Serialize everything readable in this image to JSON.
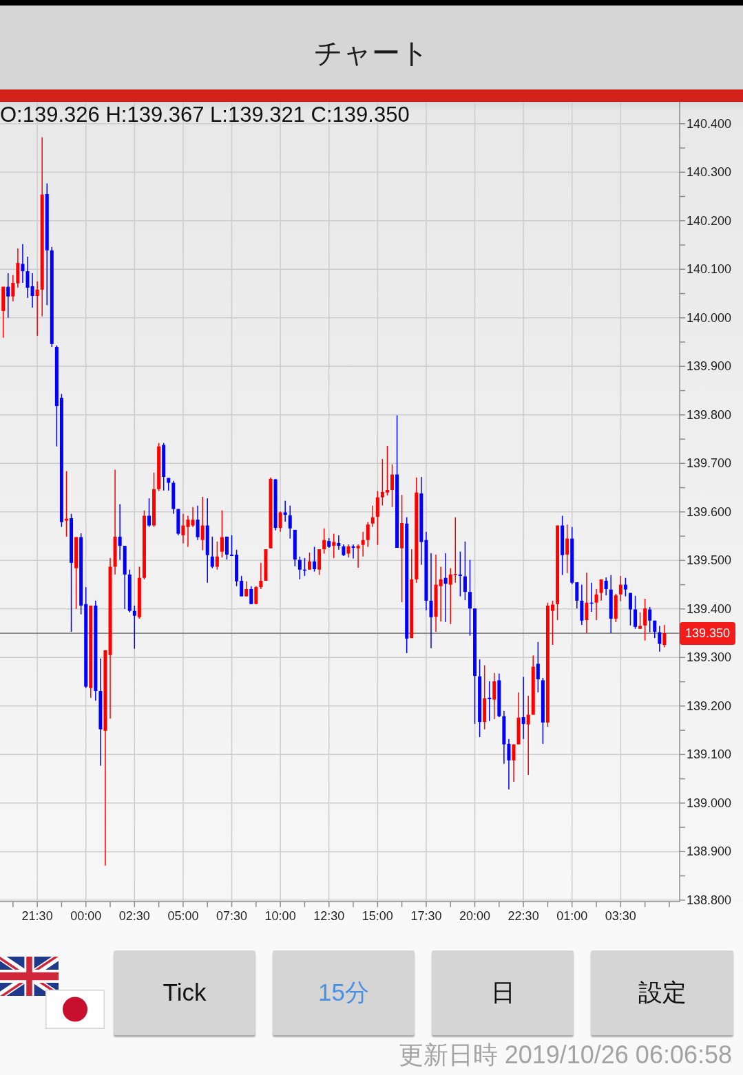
{
  "header": {
    "title": "チャート"
  },
  "chart": {
    "ohlc_readout": "O:139.326 H:139.367 L:139.321 C:139.350",
    "chart_data": {
      "type": "candlestick",
      "grid": true,
      "x": [
        "2019-10-24T19:45",
        "2019-10-24T20:00",
        "2019-10-24T20:15",
        "2019-10-24T20:30",
        "2019-10-24T20:45",
        "2019-10-24T21:00",
        "2019-10-24T21:15",
        "2019-10-24T21:30",
        "2019-10-24T21:45",
        "2019-10-24T22:00",
        "2019-10-24T22:15",
        "2019-10-24T22:30",
        "2019-10-24T22:45",
        "2019-10-24T23:00",
        "2019-10-24T23:15",
        "2019-10-24T23:30",
        "2019-10-24T23:45",
        "2019-10-25T00:00",
        "2019-10-25T00:15",
        "2019-10-25T00:30",
        "2019-10-25T00:45",
        "2019-10-25T01:00",
        "2019-10-25T01:15",
        "2019-10-25T01:30",
        "2019-10-25T01:45",
        "2019-10-25T02:00",
        "2019-10-25T02:15",
        "2019-10-25T02:30",
        "2019-10-25T02:45",
        "2019-10-25T03:00",
        "2019-10-25T03:15",
        "2019-10-25T03:30",
        "2019-10-25T03:45",
        "2019-10-25T04:00",
        "2019-10-25T04:15",
        "2019-10-25T04:30",
        "2019-10-25T04:45",
        "2019-10-25T05:00",
        "2019-10-25T05:15",
        "2019-10-25T05:30",
        "2019-10-25T05:45",
        "2019-10-25T06:00",
        "2019-10-25T06:15",
        "2019-10-25T06:30",
        "2019-10-25T06:45",
        "2019-10-25T07:00",
        "2019-10-25T07:15",
        "2019-10-25T07:30",
        "2019-10-25T07:45",
        "2019-10-25T08:00",
        "2019-10-25T08:15",
        "2019-10-25T08:30",
        "2019-10-25T08:45",
        "2019-10-25T09:00",
        "2019-10-25T09:15",
        "2019-10-25T09:30",
        "2019-10-25T09:45",
        "2019-10-25T10:00",
        "2019-10-25T10:15",
        "2019-10-25T10:30",
        "2019-10-25T10:45",
        "2019-10-25T11:00",
        "2019-10-25T11:15",
        "2019-10-25T11:30",
        "2019-10-25T11:45",
        "2019-10-25T12:00",
        "2019-10-25T12:15",
        "2019-10-25T12:30",
        "2019-10-25T12:45",
        "2019-10-25T13:00",
        "2019-10-25T13:15",
        "2019-10-25T13:30",
        "2019-10-25T13:45",
        "2019-10-25T14:00",
        "2019-10-25T14:15",
        "2019-10-25T14:30",
        "2019-10-25T14:45",
        "2019-10-25T15:00",
        "2019-10-25T15:15",
        "2019-10-25T15:30",
        "2019-10-25T15:45",
        "2019-10-25T16:00",
        "2019-10-25T16:15",
        "2019-10-25T16:30",
        "2019-10-25T16:45",
        "2019-10-25T17:00",
        "2019-10-25T17:15",
        "2019-10-25T17:30",
        "2019-10-25T17:45",
        "2019-10-25T18:00",
        "2019-10-25T18:15",
        "2019-10-25T18:30",
        "2019-10-25T18:45",
        "2019-10-25T19:00",
        "2019-10-25T19:15",
        "2019-10-25T19:30",
        "2019-10-25T19:45",
        "2019-10-25T20:00",
        "2019-10-25T20:15",
        "2019-10-25T20:30",
        "2019-10-25T20:45",
        "2019-10-25T21:00",
        "2019-10-25T21:15",
        "2019-10-25T21:30",
        "2019-10-25T21:45",
        "2019-10-25T22:00",
        "2019-10-25T22:15",
        "2019-10-25T22:30",
        "2019-10-25T22:45",
        "2019-10-25T23:00",
        "2019-10-25T23:15",
        "2019-10-25T23:30",
        "2019-10-25T23:45",
        "2019-10-26T00:00",
        "2019-10-26T00:15",
        "2019-10-26T00:30",
        "2019-10-26T00:45",
        "2019-10-26T01:00",
        "2019-10-26T01:15",
        "2019-10-26T01:30",
        "2019-10-26T01:45",
        "2019-10-26T02:00",
        "2019-10-26T02:15",
        "2019-10-26T02:30",
        "2019-10-26T02:45",
        "2019-10-26T03:00",
        "2019-10-26T03:15",
        "2019-10-26T03:30",
        "2019-10-26T03:45",
        "2019-10-26T04:00",
        "2019-10-26T04:15",
        "2019-10-26T04:30",
        "2019-10-26T04:45",
        "2019-10-26T05:00",
        "2019-10-26T05:15",
        "2019-10-26T05:30",
        "2019-10-26T05:45"
      ],
      "ohlc": [
        [
          140.014,
          140.064,
          139.959,
          140.064
        ],
        [
          140.064,
          140.092,
          140.0,
          140.044
        ],
        [
          140.044,
          140.088,
          140.034,
          140.072
        ],
        [
          140.071,
          140.143,
          140.062,
          140.113
        ],
        [
          140.111,
          140.152,
          140.072,
          140.096
        ],
        [
          140.096,
          140.126,
          140.041,
          140.062
        ],
        [
          140.065,
          140.092,
          140.021,
          140.045
        ],
        [
          140.045,
          140.075,
          139.963,
          140.058
        ],
        [
          140.058,
          140.372,
          140.003,
          140.254
        ],
        [
          140.255,
          140.277,
          140.026,
          140.139
        ],
        [
          140.139,
          140.146,
          139.94,
          139.946
        ],
        [
          139.94,
          139.943,
          139.735,
          139.818
        ],
        [
          139.835,
          139.843,
          139.569,
          139.579
        ],
        [
          139.582,
          139.684,
          139.549,
          139.586
        ],
        [
          139.587,
          139.596,
          139.353,
          139.495
        ],
        [
          139.484,
          139.548,
          139.4,
          139.548
        ],
        [
          139.548,
          139.556,
          139.389,
          139.407
        ],
        [
          139.41,
          139.445,
          139.237,
          139.24
        ],
        [
          139.237,
          139.407,
          139.217,
          139.407
        ],
        [
          139.407,
          139.417,
          139.211,
          139.231
        ],
        [
          139.231,
          139.298,
          139.077,
          139.152
        ],
        [
          139.149,
          139.315,
          138.871,
          139.315
        ],
        [
          139.305,
          139.505,
          139.174,
          139.487
        ],
        [
          139.487,
          139.687,
          139.471,
          139.549
        ],
        [
          139.549,
          139.616,
          139.501,
          139.53
        ],
        [
          139.53,
          139.53,
          139.4,
          139.471
        ],
        [
          139.471,
          139.481,
          139.393,
          139.396
        ],
        [
          139.396,
          139.407,
          139.318,
          139.386
        ],
        [
          139.383,
          139.487,
          139.38,
          139.464
        ],
        [
          139.464,
          139.603,
          139.461,
          139.592
        ],
        [
          139.592,
          139.628,
          139.569,
          139.572
        ],
        [
          139.572,
          139.681,
          139.569,
          139.647
        ],
        [
          139.647,
          139.742,
          139.643,
          139.735
        ],
        [
          139.738,
          139.742,
          139.644,
          139.672
        ],
        [
          139.67,
          139.67,
          139.644,
          139.66
        ],
        [
          139.66,
          139.664,
          139.596,
          139.606
        ],
        [
          139.606,
          139.606,
          139.552,
          139.555
        ],
        [
          139.552,
          139.596,
          139.535,
          139.572
        ],
        [
          139.569,
          139.592,
          139.528,
          139.584
        ],
        [
          139.572,
          139.61,
          139.569,
          139.584
        ],
        [
          139.584,
          139.613,
          139.542,
          139.548
        ],
        [
          139.542,
          139.631,
          139.521,
          139.572
        ],
        [
          139.572,
          139.628,
          139.454,
          139.511
        ],
        [
          139.508,
          139.549,
          139.484,
          139.487
        ],
        [
          139.487,
          139.539,
          139.481,
          139.508
        ],
        [
          139.518,
          139.603,
          139.506,
          139.548
        ],
        [
          139.549,
          139.549,
          139.502,
          139.512
        ],
        [
          139.512,
          139.552,
          139.509,
          139.509
        ],
        [
          139.512,
          139.522,
          139.447,
          139.457
        ],
        [
          139.458,
          139.468,
          139.426,
          139.426
        ],
        [
          139.426,
          139.457,
          139.426,
          139.441
        ],
        [
          139.441,
          139.447,
          139.41,
          139.41
        ],
        [
          139.41,
          139.447,
          139.41,
          139.445
        ],
        [
          139.445,
          139.495,
          139.441,
          139.458
        ],
        [
          139.458,
          139.523,
          139.458,
          139.523
        ],
        [
          139.525,
          139.671,
          139.525,
          139.668
        ],
        [
          139.667,
          139.668,
          139.562,
          139.567
        ],
        [
          139.567,
          139.601,
          139.559,
          139.599
        ],
        [
          139.599,
          139.623,
          139.58,
          139.594
        ],
        [
          139.593,
          139.613,
          139.545,
          139.566
        ],
        [
          139.563,
          139.563,
          139.488,
          139.502
        ],
        [
          139.501,
          139.508,
          139.461,
          139.481
        ],
        [
          139.481,
          139.505,
          139.468,
          139.479
        ],
        [
          139.481,
          139.516,
          139.481,
          139.498
        ],
        [
          139.498,
          139.528,
          139.477,
          139.482
        ],
        [
          139.481,
          139.523,
          139.47,
          139.523
        ],
        [
          139.523,
          139.566,
          139.514,
          139.542
        ],
        [
          139.54,
          139.546,
          139.526,
          139.528
        ],
        [
          139.53,
          139.555,
          139.505,
          139.538
        ],
        [
          139.536,
          139.552,
          139.522,
          139.53
        ],
        [
          139.529,
          139.533,
          139.509,
          139.511
        ],
        [
          139.514,
          139.533,
          139.506,
          139.529
        ],
        [
          139.529,
          139.533,
          139.504,
          139.526
        ],
        [
          139.525,
          139.533,
          139.485,
          139.53
        ],
        [
          139.532,
          139.559,
          139.508,
          139.542
        ],
        [
          139.542,
          139.579,
          139.528,
          139.574
        ],
        [
          139.576,
          139.613,
          139.569,
          139.589
        ],
        [
          139.59,
          139.643,
          139.532,
          139.63
        ],
        [
          139.63,
          139.709,
          139.613,
          139.641
        ],
        [
          139.64,
          139.736,
          139.634,
          139.645
        ],
        [
          139.645,
          139.698,
          139.61,
          139.677
        ],
        [
          139.677,
          139.799,
          139.526,
          139.526
        ],
        [
          139.525,
          139.635,
          139.414,
          139.577
        ],
        [
          139.576,
          139.589,
          139.309,
          139.339
        ],
        [
          139.34,
          139.523,
          139.34,
          139.461
        ],
        [
          139.461,
          139.671,
          139.454,
          139.64
        ],
        [
          139.638,
          139.672,
          139.491,
          139.538
        ],
        [
          139.542,
          139.559,
          139.397,
          139.417
        ],
        [
          139.417,
          139.515,
          139.319,
          139.383
        ],
        [
          139.384,
          139.512,
          139.353,
          139.45
        ],
        [
          139.447,
          139.487,
          139.374,
          139.461
        ],
        [
          139.464,
          139.515,
          139.373,
          139.452
        ],
        [
          139.45,
          139.484,
          139.369,
          139.471
        ],
        [
          139.47,
          139.589,
          139.454,
          139.472
        ],
        [
          139.471,
          139.518,
          139.426,
          139.468
        ],
        [
          139.467,
          139.539,
          139.418,
          139.435
        ],
        [
          139.435,
          139.501,
          139.345,
          139.401
        ],
        [
          139.401,
          139.401,
          139.163,
          139.262
        ],
        [
          139.261,
          139.296,
          139.136,
          139.167
        ],
        [
          139.167,
          139.284,
          139.152,
          139.216
        ],
        [
          139.217,
          139.251,
          139.169,
          139.214
        ],
        [
          139.213,
          139.268,
          139.173,
          139.251
        ],
        [
          139.253,
          139.267,
          139.177,
          139.179
        ],
        [
          139.179,
          139.19,
          139.081,
          139.121
        ],
        [
          139.122,
          139.132,
          139.028,
          139.088
        ],
        [
          139.088,
          139.121,
          139.044,
          139.121
        ],
        [
          139.121,
          139.228,
          139.121,
          139.176
        ],
        [
          139.177,
          139.26,
          139.132,
          139.163
        ],
        [
          139.162,
          139.221,
          139.058,
          139.182
        ],
        [
          139.182,
          139.304,
          139.182,
          139.281
        ],
        [
          139.287,
          139.332,
          139.228,
          139.255
        ],
        [
          139.253,
          139.258,
          139.122,
          139.166
        ],
        [
          139.166,
          139.413,
          139.157,
          139.407
        ],
        [
          139.396,
          139.417,
          139.326,
          139.409
        ],
        [
          139.41,
          139.572,
          139.377,
          139.572
        ],
        [
          139.572,
          139.592,
          139.47,
          139.511
        ],
        [
          139.512,
          139.574,
          139.474,
          139.545
        ],
        [
          139.545,
          139.569,
          139.451,
          139.454
        ],
        [
          139.455,
          139.455,
          139.401,
          139.417
        ],
        [
          139.417,
          139.45,
          139.367,
          139.376
        ],
        [
          139.377,
          139.475,
          139.35,
          139.413
        ],
        [
          139.413,
          139.454,
          139.394,
          139.411
        ],
        [
          139.413,
          139.441,
          139.377,
          139.43
        ],
        [
          139.433,
          139.461,
          139.417,
          139.461
        ],
        [
          139.458,
          139.465,
          139.428,
          139.441
        ],
        [
          139.44,
          139.47,
          139.35,
          139.38
        ],
        [
          139.38,
          139.431,
          139.373,
          139.428
        ],
        [
          139.43,
          139.468,
          139.416,
          139.45
        ],
        [
          139.45,
          139.464,
          139.426,
          139.44
        ],
        [
          139.433,
          139.433,
          139.366,
          139.399
        ],
        [
          139.399,
          139.427,
          139.359,
          139.363
        ],
        [
          139.359,
          139.393,
          139.359,
          139.365
        ],
        [
          139.366,
          139.421,
          139.335,
          139.401
        ],
        [
          139.399,
          139.404,
          139.352,
          139.376
        ],
        [
          139.376,
          139.376,
          139.34,
          139.353
        ],
        [
          139.352,
          139.365,
          139.312,
          139.328
        ],
        [
          139.326,
          139.367,
          139.321,
          139.35
        ]
      ],
      "xlim": [
        "2019-10-24T19:35",
        "2019-10-26T06:32"
      ],
      "ylim": [
        138.797,
        140.445
      ],
      "xticks": [
        {
          "value": "2019-10-24T21:30",
          "label": "21:30"
        },
        {
          "value": "2019-10-25T00:00",
          "label": "00:00"
        },
        {
          "value": "2019-10-25T02:30",
          "label": "02:30"
        },
        {
          "value": "2019-10-25T05:00",
          "label": "05:00"
        },
        {
          "value": "2019-10-25T07:30",
          "label": "07:30"
        },
        {
          "value": "2019-10-25T10:00",
          "label": "10:00"
        },
        {
          "value": "2019-10-25T12:30",
          "label": "12:30"
        },
        {
          "value": "2019-10-25T15:00",
          "label": "15:00"
        },
        {
          "value": "2019-10-25T17:30",
          "label": "17:30"
        },
        {
          "value": "2019-10-25T20:00",
          "label": "20:00"
        },
        {
          "value": "2019-10-25T22:30",
          "label": "22:30"
        },
        {
          "value": "2019-10-26T01:00",
          "label": "01:00"
        },
        {
          "value": "2019-10-26T03:30",
          "label": "03:30"
        }
      ],
      "yticks": [
        {
          "value": 140.4,
          "label": "140.400"
        },
        {
          "value": 140.3,
          "label": "140.300"
        },
        {
          "value": 140.2,
          "label": "140.200"
        },
        {
          "value": 140.1,
          "label": "140.100"
        },
        {
          "value": 140.0,
          "label": "140.000"
        },
        {
          "value": 139.9,
          "label": "139.900"
        },
        {
          "value": 139.8,
          "label": "139.800"
        },
        {
          "value": 139.7,
          "label": "139.700"
        },
        {
          "value": 139.6,
          "label": "139.600"
        },
        {
          "value": 139.5,
          "label": "139.500"
        },
        {
          "value": 139.4,
          "label": "139.400"
        },
        {
          "value": 139.3,
          "label": "139.300"
        },
        {
          "value": 139.2,
          "label": "139.200"
        },
        {
          "value": 139.1,
          "label": "139.100"
        },
        {
          "value": 139.0,
          "label": "139.000"
        },
        {
          "value": 138.9,
          "label": "138.900"
        },
        {
          "value": 138.8,
          "label": "138.800"
        }
      ],
      "ref_lines": [
        {
          "axis": "y",
          "value": 139.35,
          "label": "139.350"
        }
      ]
    }
  },
  "timeframes": [
    {
      "label": "Tick",
      "selected": false
    },
    {
      "label": "15分",
      "selected": true
    },
    {
      "label": "日",
      "selected": false
    }
  ],
  "settings_button": {
    "label": "設定"
  },
  "last_updated": "更新日時 2019/10/26 06:06:58"
}
